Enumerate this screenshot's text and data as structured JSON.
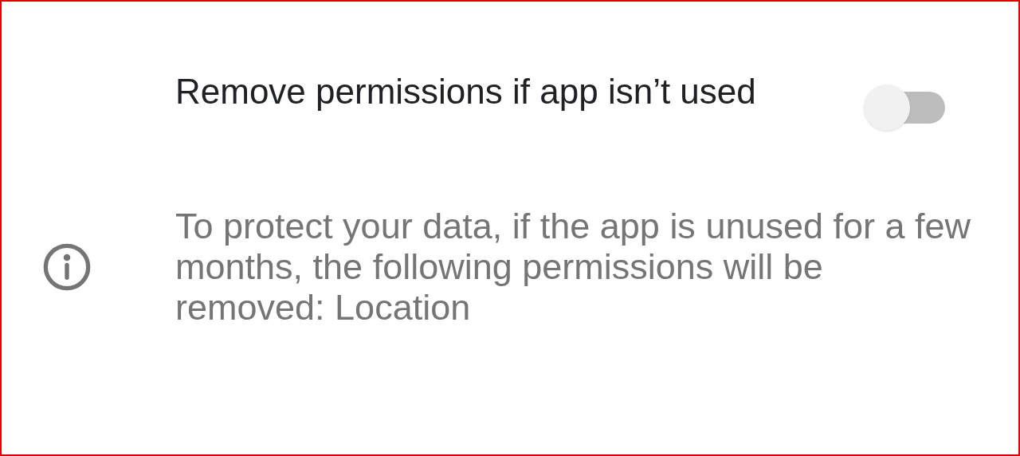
{
  "setting": {
    "title": "Remove permissions if app isn’t used",
    "on": false
  },
  "info": {
    "text": "To protect your data, if the app is unused for a few months, the following permissions will be removed: Location"
  }
}
